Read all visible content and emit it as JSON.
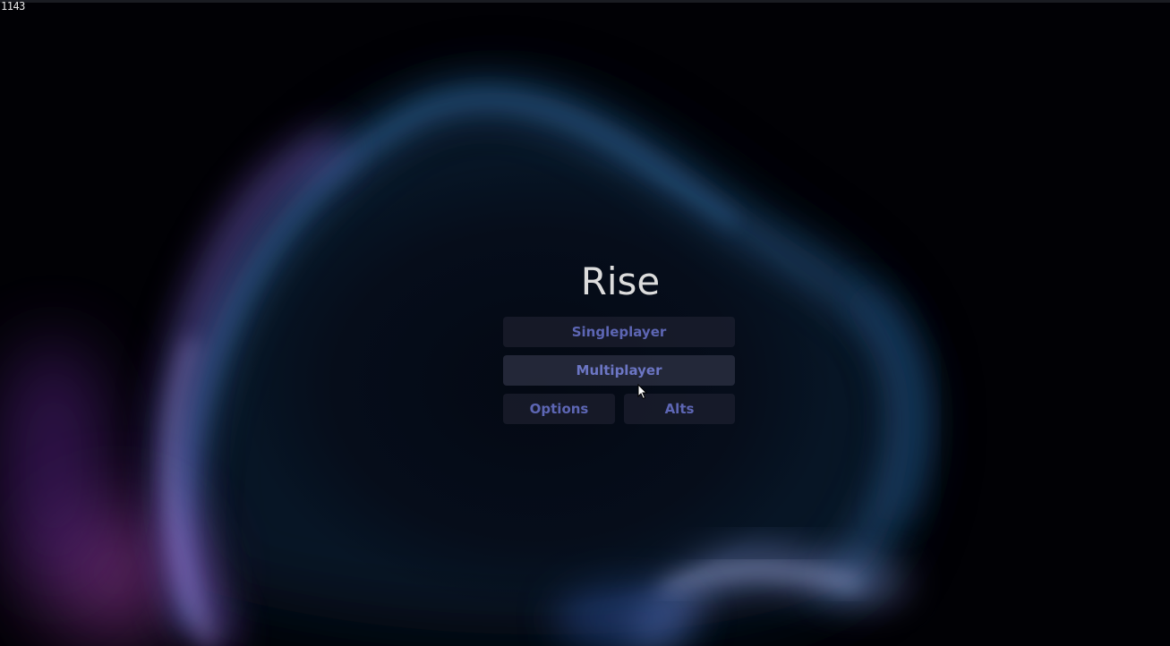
{
  "overlay": {
    "fps_counter": "1143"
  },
  "menu": {
    "title": "Rise",
    "singleplayer_label": "Singleplayer",
    "multiplayer_label": "Multiplayer",
    "options_label": "Options",
    "alts_label": "Alts",
    "hovered_button": "multiplayer"
  },
  "theme": {
    "background": "#010105",
    "button_text": "#5d66b4",
    "title_text": "#dcdcdc",
    "glow_blue": "#2f6fa8",
    "glow_purple": "#8a3ab8",
    "glow_lavender": "#9aa8f0"
  }
}
